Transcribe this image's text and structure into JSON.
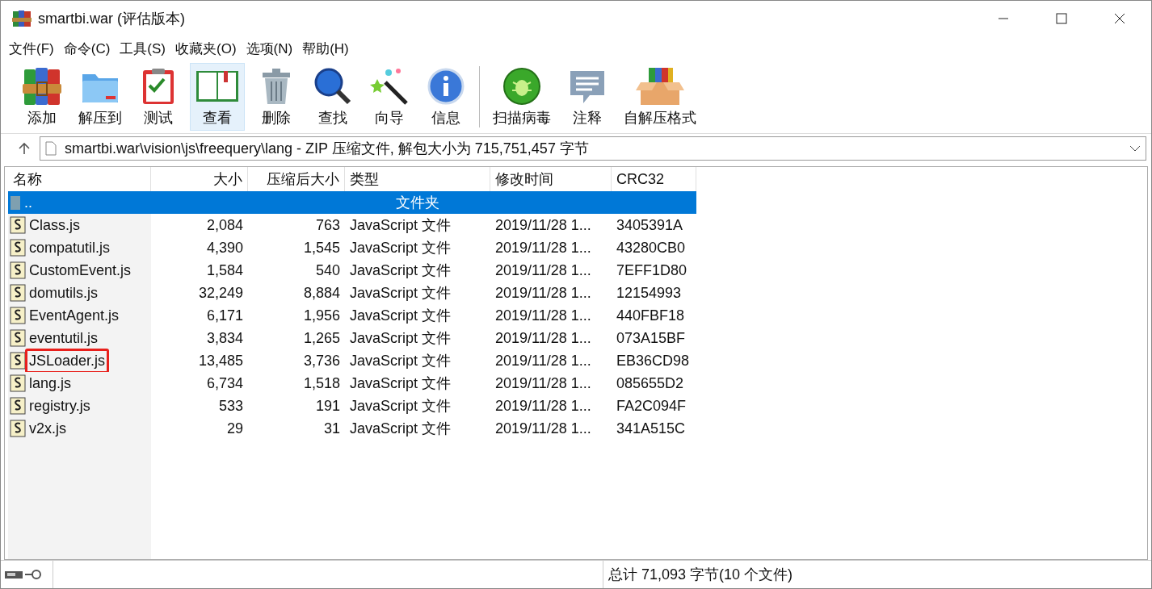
{
  "window": {
    "title": "smartbi.war (评估版本)"
  },
  "menu": [
    "文件(F)",
    "命令(C)",
    "工具(S)",
    "收藏夹(O)",
    "选项(N)",
    "帮助(H)"
  ],
  "toolbar": [
    {
      "label": "添加",
      "selected": false
    },
    {
      "label": "解压到",
      "selected": false
    },
    {
      "label": "测试",
      "selected": false
    },
    {
      "label": "查看",
      "selected": true
    },
    {
      "label": "删除",
      "selected": false
    },
    {
      "label": "查找",
      "selected": false
    },
    {
      "label": "向导",
      "selected": false
    },
    {
      "label": "信息",
      "selected": false
    },
    {
      "label": "扫描病毒",
      "selected": false
    },
    {
      "label": "注释",
      "selected": false
    },
    {
      "label": "自解压格式",
      "selected": false
    }
  ],
  "address": {
    "value": "smartbi.war\\vision\\js\\freequery\\lang - ZIP 压缩文件, 解包大小为 715,751,457 字节"
  },
  "table": {
    "columns": [
      "名称",
      "大小",
      "压缩后大小",
      "类型",
      "修改时间",
      "CRC32"
    ],
    "rows": [
      {
        "kind": "parent",
        "name": "..",
        "size": "",
        "packed": "",
        "type": "文件夹",
        "modified": "",
        "crc": "",
        "selected": true,
        "annotated": false
      },
      {
        "kind": "file",
        "name": "Class.js",
        "size": "2,084",
        "packed": "763",
        "type": "JavaScript 文件",
        "modified": "2019/11/28 1...",
        "crc": "3405391A",
        "selected": false,
        "annotated": false
      },
      {
        "kind": "file",
        "name": "compatutil.js",
        "size": "4,390",
        "packed": "1,545",
        "type": "JavaScript 文件",
        "modified": "2019/11/28 1...",
        "crc": "43280CB0",
        "selected": false,
        "annotated": false
      },
      {
        "kind": "file",
        "name": "CustomEvent.js",
        "size": "1,584",
        "packed": "540",
        "type": "JavaScript 文件",
        "modified": "2019/11/28 1...",
        "crc": "7EFF1D80",
        "selected": false,
        "annotated": false
      },
      {
        "kind": "file",
        "name": "domutils.js",
        "size": "32,249",
        "packed": "8,884",
        "type": "JavaScript 文件",
        "modified": "2019/11/28 1...",
        "crc": "12154993",
        "selected": false,
        "annotated": false
      },
      {
        "kind": "file",
        "name": "EventAgent.js",
        "size": "6,171",
        "packed": "1,956",
        "type": "JavaScript 文件",
        "modified": "2019/11/28 1...",
        "crc": "440FBF18",
        "selected": false,
        "annotated": false
      },
      {
        "kind": "file",
        "name": "eventutil.js",
        "size": "3,834",
        "packed": "1,265",
        "type": "JavaScript 文件",
        "modified": "2019/11/28 1...",
        "crc": "073A15BF",
        "selected": false,
        "annotated": false
      },
      {
        "kind": "file",
        "name": "JSLoader.js",
        "size": "13,485",
        "packed": "3,736",
        "type": "JavaScript 文件",
        "modified": "2019/11/28 1...",
        "crc": "EB36CD98",
        "selected": false,
        "annotated": true
      },
      {
        "kind": "file",
        "name": "lang.js",
        "size": "6,734",
        "packed": "1,518",
        "type": "JavaScript 文件",
        "modified": "2019/11/28 1...",
        "crc": "085655D2",
        "selected": false,
        "annotated": false
      },
      {
        "kind": "file",
        "name": "registry.js",
        "size": "533",
        "packed": "191",
        "type": "JavaScript 文件",
        "modified": "2019/11/28 1...",
        "crc": "FA2C094F",
        "selected": false,
        "annotated": false
      },
      {
        "kind": "file",
        "name": "v2x.js",
        "size": "29",
        "packed": "31",
        "type": "JavaScript 文件",
        "modified": "2019/11/28 1...",
        "crc": "341A515C",
        "selected": false,
        "annotated": false
      }
    ]
  },
  "status_bar": {
    "text": "总计 71,093 字节(10 个文件)"
  }
}
